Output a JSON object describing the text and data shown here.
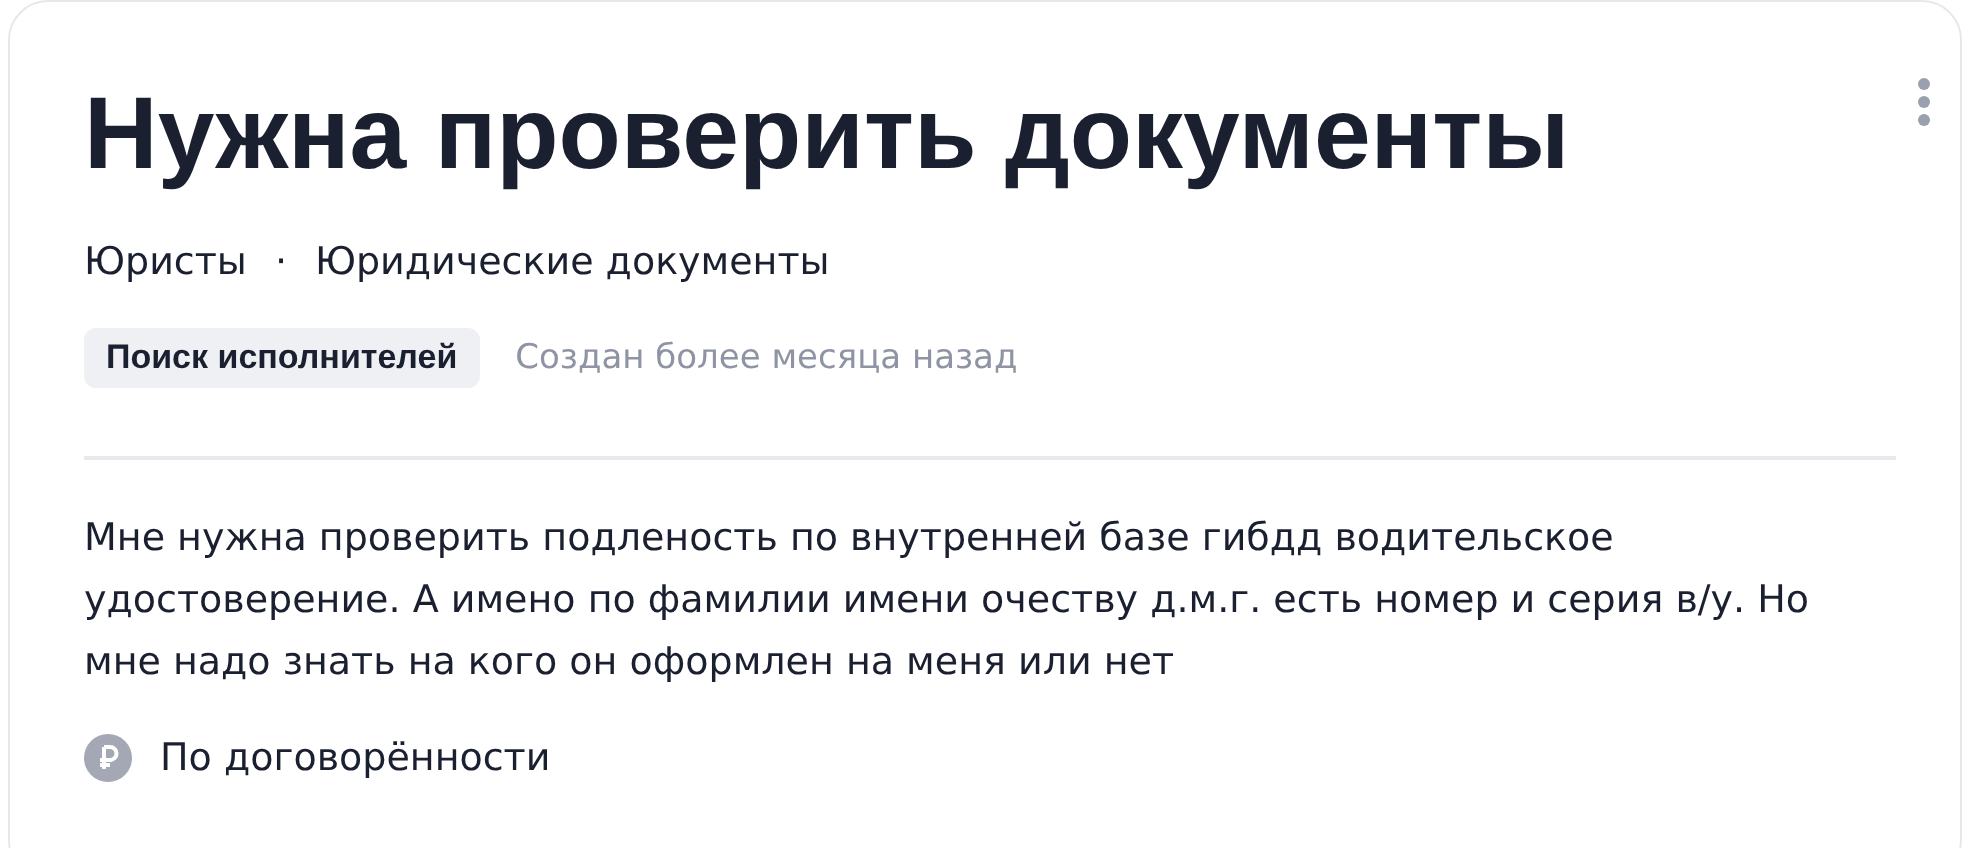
{
  "title": "Нужна проверить документы",
  "categories": [
    "Юристы",
    "Юридические документы"
  ],
  "separator": "·",
  "status": {
    "badge": "Поиск исполнителей",
    "created": "Создан более месяца назад"
  },
  "description": "Мне нужна проверить подленость по внутренней базе гибдд водительское удостоверение. А имено по фамилии имени очеству д.м.г. есть номер и серия в/у. Но мне надо знать на кого он оформлен на меня или нет",
  "price": "По договорённости"
}
